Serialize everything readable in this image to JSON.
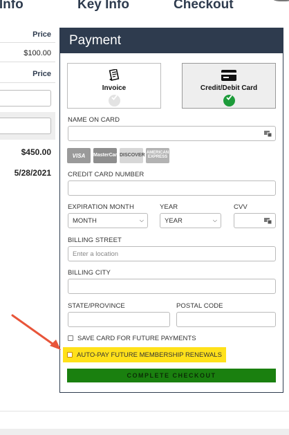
{
  "steps": [
    "n Info",
    "Key Info",
    "Checkout"
  ],
  "summary": {
    "price_header": "Price",
    "price_value": "$100.00",
    "price_header_2": "Price",
    "total": "$450.00",
    "date": "5/28/2021"
  },
  "payment": {
    "title": "Payment",
    "methods": [
      {
        "label": "Invoice",
        "icon": "invoice-icon",
        "selected": false
      },
      {
        "label": "Credit/Debit Card",
        "icon": "credit-card-icon",
        "selected": true
      }
    ],
    "name_on_card_label": "NAME ON CARD",
    "card_brands": [
      "VISA",
      "MasterCard",
      "DISCOVER",
      "AMERICAN EXPRESS"
    ],
    "card_number_label": "CREDIT CARD NUMBER",
    "exp_month_label": "EXPIRATION MONTH",
    "exp_month_value": "MONTH",
    "year_label": "YEAR",
    "year_value": "YEAR",
    "cvv_label": "CVV",
    "billing_street_label": "BILLING STREET",
    "billing_street_placeholder": "Enter a location",
    "billing_city_label": "BILLING CITY",
    "state_label": "STATE/PROVINCE",
    "postal_label": "POSTAL CODE",
    "save_card_label": "SAVE CARD FOR FUTURE PAYMENTS",
    "autopay_label": "AUTO-PAY FUTURE MEMBERSHIP RENEWALS",
    "complete_button": "COMPLETE CHECKOUT"
  },
  "colors": {
    "header": "#2e3b4e",
    "highlight": "#ffe11a",
    "complete_button": "#1a800f",
    "check": "#1d9b3a",
    "arrow": "#e8553a"
  }
}
